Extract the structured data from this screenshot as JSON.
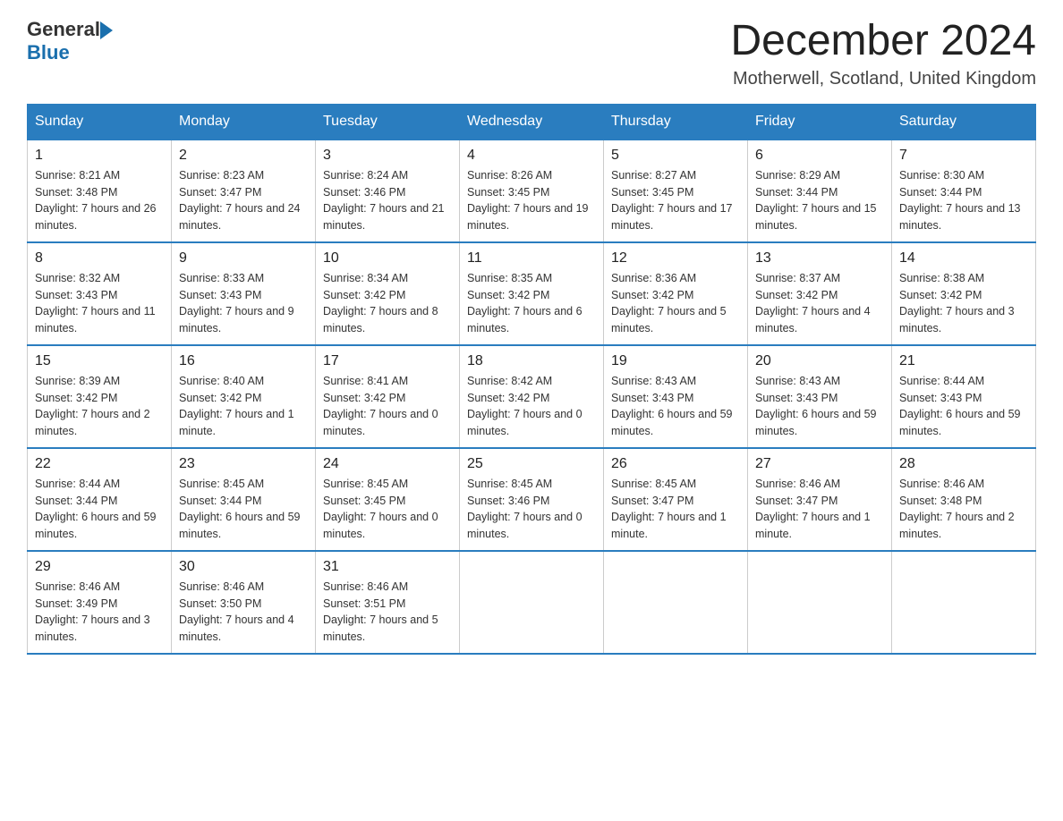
{
  "header": {
    "logo_general": "General",
    "logo_blue": "Blue",
    "month_title": "December 2024",
    "location": "Motherwell, Scotland, United Kingdom"
  },
  "days_of_week": [
    "Sunday",
    "Monday",
    "Tuesday",
    "Wednesday",
    "Thursday",
    "Friday",
    "Saturday"
  ],
  "weeks": [
    [
      {
        "day": "1",
        "sunrise": "Sunrise: 8:21 AM",
        "sunset": "Sunset: 3:48 PM",
        "daylight": "Daylight: 7 hours and 26 minutes."
      },
      {
        "day": "2",
        "sunrise": "Sunrise: 8:23 AM",
        "sunset": "Sunset: 3:47 PM",
        "daylight": "Daylight: 7 hours and 24 minutes."
      },
      {
        "day": "3",
        "sunrise": "Sunrise: 8:24 AM",
        "sunset": "Sunset: 3:46 PM",
        "daylight": "Daylight: 7 hours and 21 minutes."
      },
      {
        "day": "4",
        "sunrise": "Sunrise: 8:26 AM",
        "sunset": "Sunset: 3:45 PM",
        "daylight": "Daylight: 7 hours and 19 minutes."
      },
      {
        "day": "5",
        "sunrise": "Sunrise: 8:27 AM",
        "sunset": "Sunset: 3:45 PM",
        "daylight": "Daylight: 7 hours and 17 minutes."
      },
      {
        "day": "6",
        "sunrise": "Sunrise: 8:29 AM",
        "sunset": "Sunset: 3:44 PM",
        "daylight": "Daylight: 7 hours and 15 minutes."
      },
      {
        "day": "7",
        "sunrise": "Sunrise: 8:30 AM",
        "sunset": "Sunset: 3:44 PM",
        "daylight": "Daylight: 7 hours and 13 minutes."
      }
    ],
    [
      {
        "day": "8",
        "sunrise": "Sunrise: 8:32 AM",
        "sunset": "Sunset: 3:43 PM",
        "daylight": "Daylight: 7 hours and 11 minutes."
      },
      {
        "day": "9",
        "sunrise": "Sunrise: 8:33 AM",
        "sunset": "Sunset: 3:43 PM",
        "daylight": "Daylight: 7 hours and 9 minutes."
      },
      {
        "day": "10",
        "sunrise": "Sunrise: 8:34 AM",
        "sunset": "Sunset: 3:42 PM",
        "daylight": "Daylight: 7 hours and 8 minutes."
      },
      {
        "day": "11",
        "sunrise": "Sunrise: 8:35 AM",
        "sunset": "Sunset: 3:42 PM",
        "daylight": "Daylight: 7 hours and 6 minutes."
      },
      {
        "day": "12",
        "sunrise": "Sunrise: 8:36 AM",
        "sunset": "Sunset: 3:42 PM",
        "daylight": "Daylight: 7 hours and 5 minutes."
      },
      {
        "day": "13",
        "sunrise": "Sunrise: 8:37 AM",
        "sunset": "Sunset: 3:42 PM",
        "daylight": "Daylight: 7 hours and 4 minutes."
      },
      {
        "day": "14",
        "sunrise": "Sunrise: 8:38 AM",
        "sunset": "Sunset: 3:42 PM",
        "daylight": "Daylight: 7 hours and 3 minutes."
      }
    ],
    [
      {
        "day": "15",
        "sunrise": "Sunrise: 8:39 AM",
        "sunset": "Sunset: 3:42 PM",
        "daylight": "Daylight: 7 hours and 2 minutes."
      },
      {
        "day": "16",
        "sunrise": "Sunrise: 8:40 AM",
        "sunset": "Sunset: 3:42 PM",
        "daylight": "Daylight: 7 hours and 1 minute."
      },
      {
        "day": "17",
        "sunrise": "Sunrise: 8:41 AM",
        "sunset": "Sunset: 3:42 PM",
        "daylight": "Daylight: 7 hours and 0 minutes."
      },
      {
        "day": "18",
        "sunrise": "Sunrise: 8:42 AM",
        "sunset": "Sunset: 3:42 PM",
        "daylight": "Daylight: 7 hours and 0 minutes."
      },
      {
        "day": "19",
        "sunrise": "Sunrise: 8:43 AM",
        "sunset": "Sunset: 3:43 PM",
        "daylight": "Daylight: 6 hours and 59 minutes."
      },
      {
        "day": "20",
        "sunrise": "Sunrise: 8:43 AM",
        "sunset": "Sunset: 3:43 PM",
        "daylight": "Daylight: 6 hours and 59 minutes."
      },
      {
        "day": "21",
        "sunrise": "Sunrise: 8:44 AM",
        "sunset": "Sunset: 3:43 PM",
        "daylight": "Daylight: 6 hours and 59 minutes."
      }
    ],
    [
      {
        "day": "22",
        "sunrise": "Sunrise: 8:44 AM",
        "sunset": "Sunset: 3:44 PM",
        "daylight": "Daylight: 6 hours and 59 minutes."
      },
      {
        "day": "23",
        "sunrise": "Sunrise: 8:45 AM",
        "sunset": "Sunset: 3:44 PM",
        "daylight": "Daylight: 6 hours and 59 minutes."
      },
      {
        "day": "24",
        "sunrise": "Sunrise: 8:45 AM",
        "sunset": "Sunset: 3:45 PM",
        "daylight": "Daylight: 7 hours and 0 minutes."
      },
      {
        "day": "25",
        "sunrise": "Sunrise: 8:45 AM",
        "sunset": "Sunset: 3:46 PM",
        "daylight": "Daylight: 7 hours and 0 minutes."
      },
      {
        "day": "26",
        "sunrise": "Sunrise: 8:45 AM",
        "sunset": "Sunset: 3:47 PM",
        "daylight": "Daylight: 7 hours and 1 minute."
      },
      {
        "day": "27",
        "sunrise": "Sunrise: 8:46 AM",
        "sunset": "Sunset: 3:47 PM",
        "daylight": "Daylight: 7 hours and 1 minute."
      },
      {
        "day": "28",
        "sunrise": "Sunrise: 8:46 AM",
        "sunset": "Sunset: 3:48 PM",
        "daylight": "Daylight: 7 hours and 2 minutes."
      }
    ],
    [
      {
        "day": "29",
        "sunrise": "Sunrise: 8:46 AM",
        "sunset": "Sunset: 3:49 PM",
        "daylight": "Daylight: 7 hours and 3 minutes."
      },
      {
        "day": "30",
        "sunrise": "Sunrise: 8:46 AM",
        "sunset": "Sunset: 3:50 PM",
        "daylight": "Daylight: 7 hours and 4 minutes."
      },
      {
        "day": "31",
        "sunrise": "Sunrise: 8:46 AM",
        "sunset": "Sunset: 3:51 PM",
        "daylight": "Daylight: 7 hours and 5 minutes."
      },
      null,
      null,
      null,
      null
    ]
  ]
}
